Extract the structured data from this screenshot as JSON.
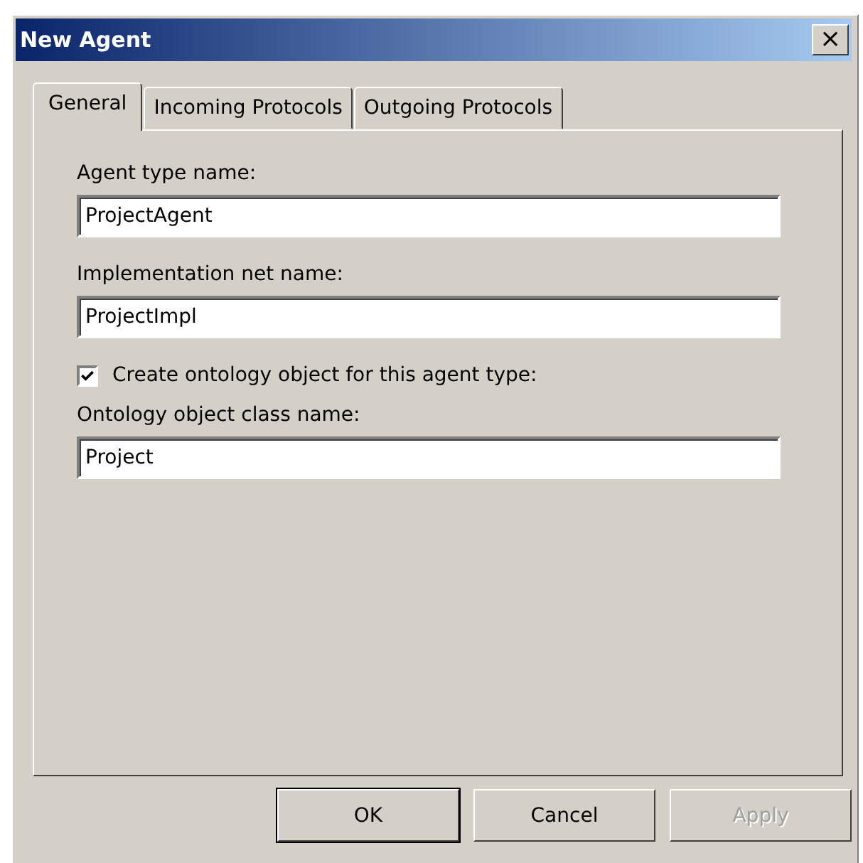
{
  "window": {
    "title": "New Agent",
    "close": "×"
  },
  "tabs": [
    {
      "label": "General",
      "selected": true
    },
    {
      "label": "Incoming Protocols",
      "selected": false
    },
    {
      "label": "Outgoing Protocols",
      "selected": false
    }
  ],
  "form": [
    {
      "kind": "field",
      "label": "Agent type name:",
      "value": "ProjectAgent"
    },
    {
      "kind": "field",
      "label": "Implementation net name:",
      "value": "ProjectImpl"
    },
    {
      "kind": "checkbox",
      "label": "Create ontology object for this agent type:",
      "checked": true
    },
    {
      "kind": "field",
      "label": "Ontology object class name:",
      "value": "Project"
    }
  ],
  "buttons": [
    {
      "label": "OK",
      "default": true,
      "disabled": false
    },
    {
      "label": "Cancel",
      "default": false,
      "disabled": false
    },
    {
      "label": "Apply",
      "default": false,
      "disabled": true
    }
  ]
}
